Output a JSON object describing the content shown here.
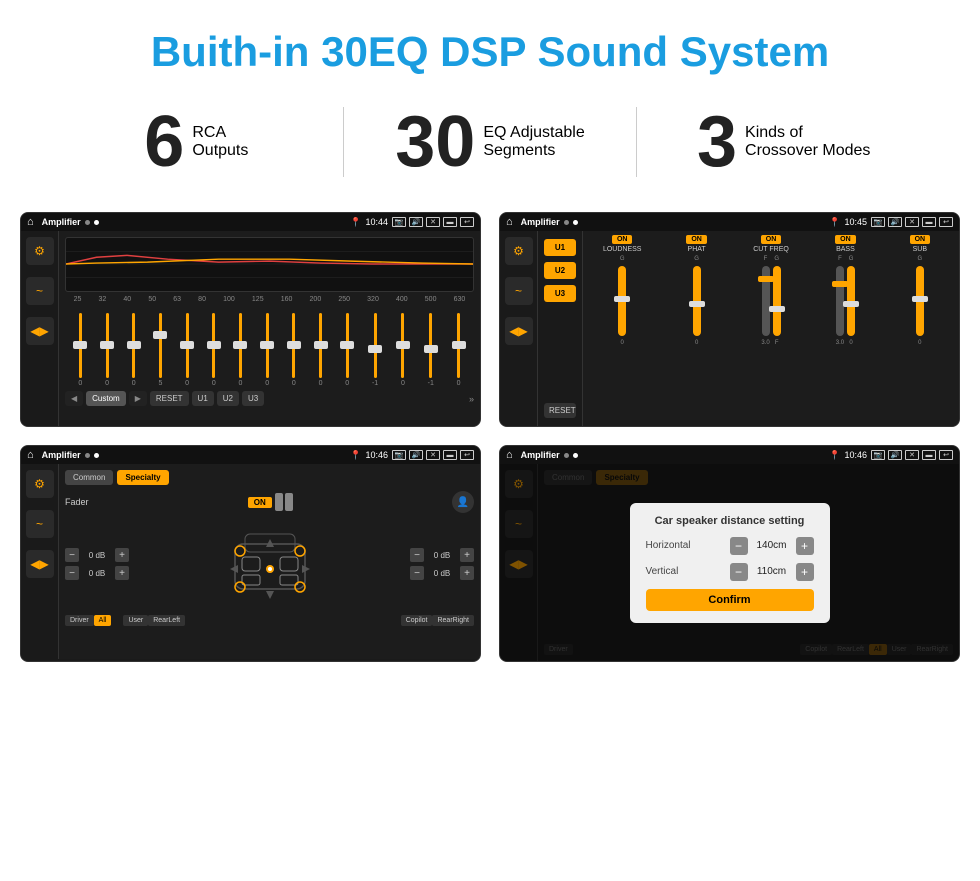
{
  "page": {
    "title": "Buith-in 30EQ DSP Sound System"
  },
  "stats": [
    {
      "number": "6",
      "label_line1": "RCA",
      "label_line2": "Outputs"
    },
    {
      "number": "30",
      "label_line1": "EQ Adjustable",
      "label_line2": "Segments"
    },
    {
      "number": "3",
      "label_line1": "Kinds of",
      "label_line2": "Crossover Modes"
    }
  ],
  "screens": [
    {
      "id": "eq-screen",
      "status": {
        "app": "Amplifier",
        "time": "10:44"
      },
      "type": "equalizer",
      "eq_labels": [
        "25",
        "32",
        "40",
        "50",
        "63",
        "80",
        "100",
        "125",
        "160",
        "200",
        "250",
        "320",
        "400",
        "500",
        "630"
      ],
      "eq_values": [
        "0",
        "0",
        "0",
        "5",
        "0",
        "0",
        "0",
        "0",
        "0",
        "0",
        "0",
        "-1",
        "0",
        "-1"
      ],
      "eq_buttons": [
        "Custom",
        "RESET",
        "U1",
        "U2",
        "U3"
      ]
    },
    {
      "id": "crossover-screen",
      "status": {
        "app": "Amplifier",
        "time": "10:45"
      },
      "type": "crossover",
      "u_buttons": [
        "U1",
        "U2",
        "U3"
      ],
      "channels": [
        {
          "name": "LOUDNESS",
          "on": true
        },
        {
          "name": "PHAT",
          "on": true
        },
        {
          "name": "CUT FREQ",
          "on": true
        },
        {
          "name": "BASS",
          "on": true
        },
        {
          "name": "SUB",
          "on": true
        }
      ],
      "reset_label": "RESET"
    },
    {
      "id": "fader-screen",
      "status": {
        "app": "Amplifier",
        "time": "10:46"
      },
      "type": "fader",
      "tabs": [
        "Common",
        "Specialty"
      ],
      "active_tab": "Specialty",
      "fader_label": "Fader",
      "fader_on": "ON",
      "db_values": [
        "0 dB",
        "0 dB",
        "0 dB",
        "0 dB"
      ],
      "bottom_buttons": [
        "Driver",
        "All",
        "User",
        "RearLeft",
        "Copilot",
        "RearRight"
      ]
    },
    {
      "id": "dialog-screen",
      "status": {
        "app": "Amplifier",
        "time": "10:46"
      },
      "type": "dialog",
      "tabs": [
        "Common",
        "Specialty"
      ],
      "dialog": {
        "title": "Car speaker distance setting",
        "horizontal_label": "Horizontal",
        "horizontal_value": "140cm",
        "vertical_label": "Vertical",
        "vertical_value": "110cm",
        "confirm_label": "Confirm"
      }
    }
  ]
}
